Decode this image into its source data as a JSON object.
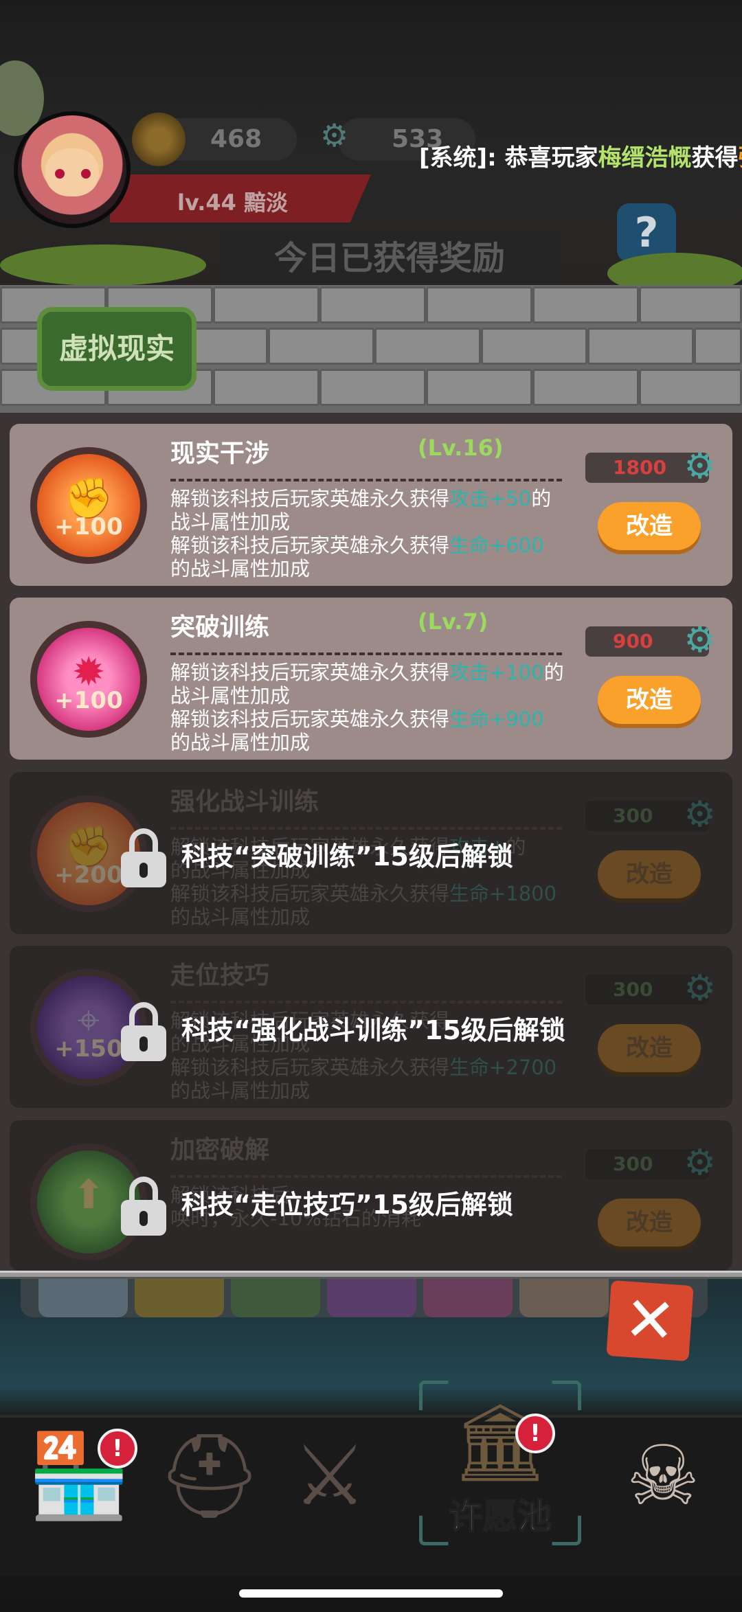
{
  "hud": {
    "coins": "468",
    "gears": "533",
    "system_prefix": "[系统]: 恭喜玩家",
    "system_name": "梅缙浩慨",
    "system_mid": "获得",
    "system_tail": "强",
    "level_text": "lv.44  黯淡",
    "help_label": "?",
    "today_reward": "今日已获得奖励"
  },
  "section_badge": "虚拟现实",
  "tech_items": [
    {
      "title": "现实干涉",
      "level": "(Lv.16)",
      "cost": "1800",
      "cost_color": "#d94040",
      "d1a": "解锁该科技后玩家英雄永久获得",
      "d1s": "攻击+",
      "d1v": "50",
      "d1b": "的",
      "d1c": "战斗属性加成",
      "d2a": "解锁该科技后玩家英雄永久获得",
      "d2s": "生命+",
      "d2v": "600",
      "d2c": "的战斗属性加成",
      "medal_plus": "+100",
      "button": "改造",
      "locked": false,
      "lock_text": ""
    },
    {
      "title": "突破训练",
      "level": "(Lv.7)",
      "cost": "900",
      "cost_color": "#d94040",
      "d1a": "解锁该科技后玩家英雄永久获得",
      "d1s": "攻击+",
      "d1v": "100",
      "d1b": "的",
      "d1c": "战斗属性加成",
      "d2a": "解锁该科技后玩家英雄永久获得",
      "d2s": "生命+",
      "d2v": "900",
      "d2c": "的战斗属性加成",
      "medal_plus": "+100",
      "button": "改造",
      "locked": false,
      "lock_text": ""
    },
    {
      "title": "强化战斗训练",
      "level": "",
      "cost": "300",
      "cost_color": "#3b4a37",
      "d1a": "解锁该科技后玩家英雄永久获得",
      "d1s": "攻击+",
      "d1v": "",
      "d1b": "的",
      "d1c": "的战斗属性加成",
      "d2a": "解锁该科技后玩家英雄永久获得",
      "d2s": "生命+",
      "d2v": "1800",
      "d2c": "的战斗属性加成",
      "medal_plus": "+200",
      "button": "改造",
      "locked": true,
      "lock_text": "科技“突破训练”15级后解锁"
    },
    {
      "title": "走位技巧",
      "level": "",
      "cost": "300",
      "cost_color": "#3b4a37",
      "d1a": "解锁该科技后玩家英雄永久获得",
      "d1s": "",
      "d1v": "",
      "d1b": "",
      "d1c": "的战斗属性加成",
      "d2a": "解锁该科技后玩家英雄永久获得",
      "d2s": "生命+",
      "d2v": "2700",
      "d2c": "的战斗属性加成",
      "medal_plus": "+150",
      "button": "改造",
      "locked": true,
      "lock_text": "科技“强化战斗训练”15级后解锁"
    },
    {
      "title": "加密破解",
      "level": "",
      "cost": "300",
      "cost_color": "#3b4a37",
      "d1a": "解锁该科技后",
      "d1s": "",
      "d1v": "",
      "d1b": "",
      "d1c": "唤时，永久-10%钻石的消耗",
      "d2a": "",
      "d2s": "",
      "d2v": "",
      "d2c": "",
      "medal_plus": "",
      "button": "改造",
      "locked": true,
      "lock_text": "科技“走位技巧”15级后解锁"
    }
  ],
  "close_label": "✕",
  "nav": {
    "wish_label": "许愿池",
    "badge": "!"
  },
  "colors": {
    "accent_orange": "#f9a12a",
    "stat_teal": "#2bb5ab",
    "level_green": "#9bd95f"
  }
}
